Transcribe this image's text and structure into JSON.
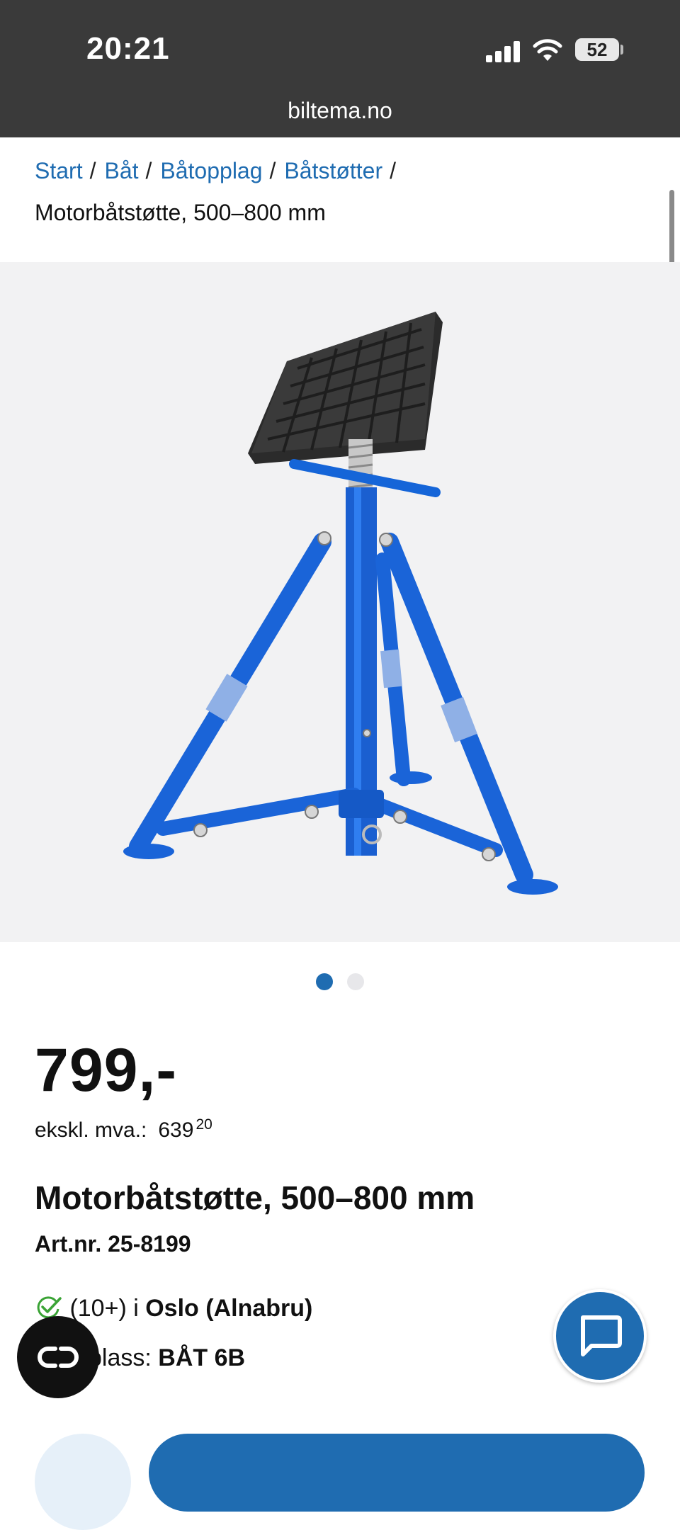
{
  "status_bar": {
    "time": "20:21",
    "battery": "52",
    "url": "biltema.no"
  },
  "breadcrumb": {
    "items": [
      "Start",
      "Båt",
      "Båtopplag",
      "Båtstøtter"
    ],
    "separator": "/",
    "current": "Motorbåtstøtte, 500–800 mm"
  },
  "gallery": {
    "image": "blue-tripod-boat-stand-with-rubber-pad",
    "dots_total": 2,
    "active_dot": 1
  },
  "product": {
    "price": "799,-",
    "ex_vat_label": "ekskl. mva.:",
    "ex_vat_whole": "639",
    "ex_vat_cents": "20",
    "title": "Motorbåtstøtte, 500–800 mm",
    "art_nr": "Art.nr. 25-8199",
    "stock_count": "(10+) i",
    "stock_store": "Oslo (Alnabru)",
    "shelf_label_visible": "plass:",
    "shelf_value": "BÅT 6B"
  },
  "colors": {
    "accent": "#1f6cb1",
    "status_bar": "#3a3a3a",
    "gallery_bg": "#f2f2f3",
    "stock_check": "#3aa335"
  },
  "icons": {
    "chat": "chat-bubble-icon",
    "co": "co-icon",
    "check": "check-icon"
  }
}
